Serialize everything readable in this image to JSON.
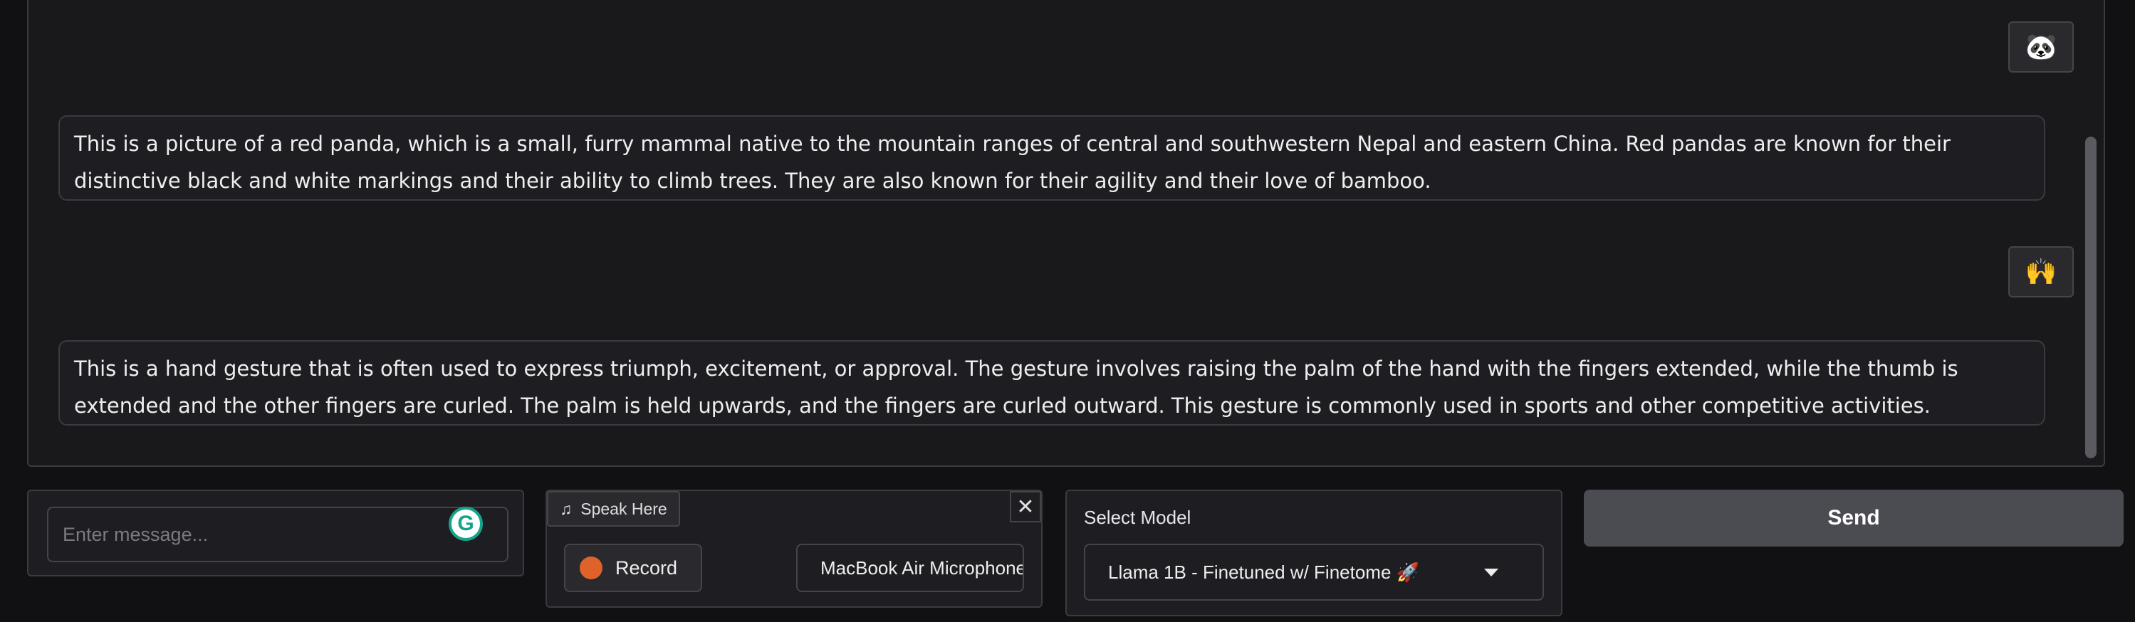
{
  "chat": {
    "messages": [
      {
        "role": "user",
        "content_icon": "panda-emoji",
        "glyph": "🐼"
      },
      {
        "role": "bot",
        "text": "This is a picture of a red panda, which is a small, furry mammal native to the mountain ranges of central and southwestern Nepal and eastern China. Red pandas are known for their distinctive black and white markings and their ability to climb trees. They are also known for their agility and their love of bamboo."
      },
      {
        "role": "user",
        "content_icon": "raising-hands-emoji",
        "glyph": "🙌"
      },
      {
        "role": "bot",
        "text": "This is a hand gesture that is often used to express triumph, excitement, or approval. The gesture involves raising the palm of the hand with the fingers extended, while the thumb is extended and the other fingers are curled. The palm is held upwards, and the fingers are curled outward. This gesture is commonly used in sports and other competitive activities."
      }
    ]
  },
  "input": {
    "placeholder": "Enter message...",
    "value": ""
  },
  "audio": {
    "tab_label": "Speak Here",
    "record_label": "Record",
    "microphone": "MacBook Air Microphone"
  },
  "model": {
    "label": "Select Model",
    "selected": "Llama 1B - Finetuned w/ Finetome 🚀"
  },
  "send_label": "Send",
  "colors": {
    "record_dot": "#e0622b",
    "send_bg": "#4b4b52",
    "panel_bg": "#19191c"
  }
}
